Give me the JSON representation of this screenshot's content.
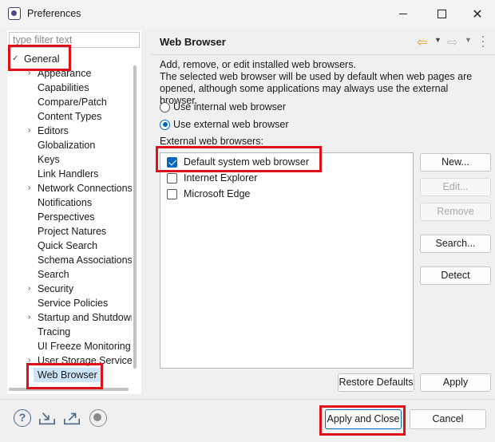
{
  "window": {
    "title": "Preferences"
  },
  "left": {
    "filter_placeholder": "type filter text",
    "tree": [
      {
        "label": "General",
        "chevron": "✓",
        "level": 0
      },
      {
        "label": "Appearance",
        "chevron": "›",
        "level": 1
      },
      {
        "label": "Capabilities",
        "chevron": "",
        "level": 1
      },
      {
        "label": "Compare/Patch",
        "chevron": "",
        "level": 1
      },
      {
        "label": "Content Types",
        "chevron": "",
        "level": 1
      },
      {
        "label": "Editors",
        "chevron": "›",
        "level": 1
      },
      {
        "label": "Globalization",
        "chevron": "",
        "level": 1
      },
      {
        "label": "Keys",
        "chevron": "",
        "level": 1
      },
      {
        "label": "Link Handlers",
        "chevron": "",
        "level": 1
      },
      {
        "label": "Network Connections",
        "chevron": "›",
        "level": 1
      },
      {
        "label": "Notifications",
        "chevron": "",
        "level": 1
      },
      {
        "label": "Perspectives",
        "chevron": "",
        "level": 1
      },
      {
        "label": "Project Natures",
        "chevron": "",
        "level": 1
      },
      {
        "label": "Quick Search",
        "chevron": "",
        "level": 1
      },
      {
        "label": "Schema Associations",
        "chevron": "",
        "level": 1
      },
      {
        "label": "Search",
        "chevron": "",
        "level": 1
      },
      {
        "label": "Security",
        "chevron": "›",
        "level": 1
      },
      {
        "label": "Service Policies",
        "chevron": "",
        "level": 1
      },
      {
        "label": "Startup and Shutdown",
        "chevron": "›",
        "level": 1
      },
      {
        "label": "Tracing",
        "chevron": "",
        "level": 1
      },
      {
        "label": "UI Freeze Monitoring",
        "chevron": "",
        "level": 1
      },
      {
        "label": "User Storage Service",
        "chevron": "›",
        "level": 1
      },
      {
        "label": "Web Browser",
        "chevron": "",
        "level": 1
      }
    ]
  },
  "main": {
    "title": "Web Browser",
    "description": [
      "Add, remove, or edit installed web browsers.",
      "The selected web browser will be used by default when web pages are",
      "opened, although some applications may always use the external browser."
    ],
    "radio_internal": "Use internal web browser",
    "radio_external": "Use external web browser",
    "list_label": "External web browsers:",
    "browsers": [
      {
        "label": "Default system web browser",
        "checked": true
      },
      {
        "label": "Internet Explorer",
        "checked": false
      },
      {
        "label": "Microsoft Edge",
        "checked": false
      }
    ],
    "buttons": {
      "new": "New...",
      "edit": "Edit...",
      "remove": "Remove",
      "search": "Search...",
      "detect": "Detect",
      "restore": "Restore Defaults",
      "apply": "Apply"
    }
  },
  "footer": {
    "apply_close": "Apply and Close",
    "cancel": "Cancel"
  },
  "colors": {
    "accent": "#0067c0",
    "highlight": "#e0101a",
    "selection": "#cce4f7"
  }
}
